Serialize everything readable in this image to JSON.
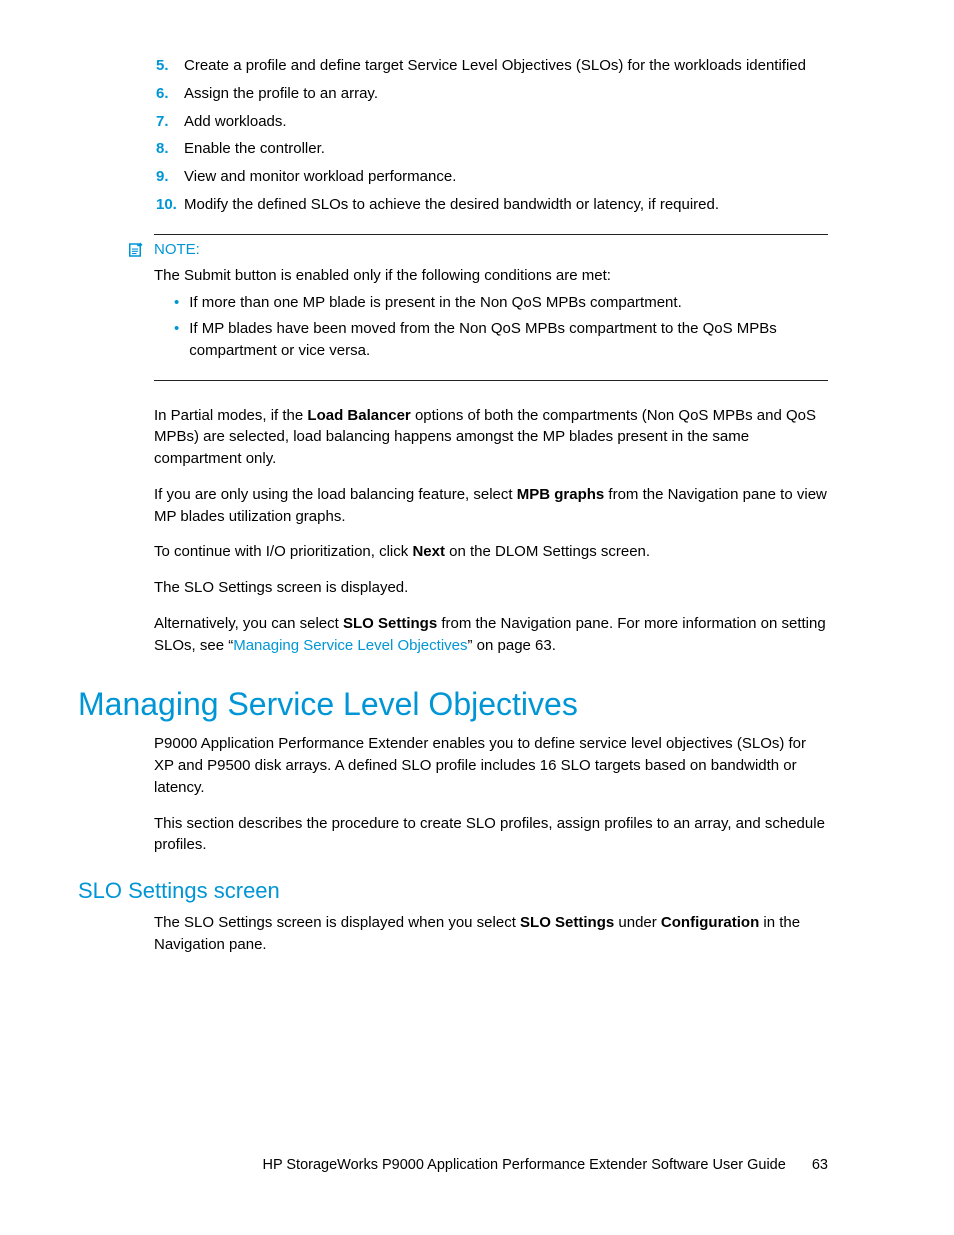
{
  "ol": [
    {
      "n": "5.",
      "t": "Create a profile and define target Service Level Objectives (SLOs) for the workloads identified"
    },
    {
      "n": "6.",
      "t": "Assign the profile to an array."
    },
    {
      "n": "7.",
      "t": "Add workloads."
    },
    {
      "n": "8.",
      "t": "Enable the controller."
    },
    {
      "n": "9.",
      "t": "View and monitor workload performance."
    },
    {
      "n": "10.",
      "t": "Modify the defined SLOs to achieve the desired bandwidth or latency, if required."
    }
  ],
  "note": {
    "label": "NOTE:",
    "intro": "The Submit button is enabled only if the following conditions are met:",
    "bullets": [
      "If more than one MP blade is present in the Non QoS MPBs compartment.",
      "If MP blades have been moved from the Non QoS MPBs compartment to the QoS MPBs compartment or vice versa."
    ]
  },
  "p1": {
    "a": "In Partial modes, if the ",
    "b": "Load Balancer",
    "c": " options of both the compartments (Non QoS MPBs and QoS MPBs) are selected, load balancing happens amongst the MP blades present in the same compartment only."
  },
  "p2": {
    "a": "If you are only using the load balancing feature, select ",
    "b": "MPB graphs",
    "c": " from the Navigation pane to view MP blades utilization graphs."
  },
  "p3": {
    "a": "To continue with I/O prioritization, click ",
    "b": "Next",
    "c": " on the DLOM Settings screen."
  },
  "p4": "The SLO Settings screen is displayed.",
  "p5": {
    "a": "Alternatively, you can select ",
    "b": "SLO Settings",
    "c": " from the Navigation pane. For more information on setting SLOs, see “",
    "link": "Managing Service Level Objectives",
    "d": "” on page 63."
  },
  "h1": "Managing Service Level Objectives",
  "s1p1": "P9000 Application Performance Extender enables you to define service level objectives (SLOs) for XP and P9500 disk arrays. A defined SLO profile includes 16 SLO targets based on bandwidth or latency.",
  "s1p2": "This section describes the procedure to create SLO profiles, assign profiles to an array, and schedule profiles.",
  "h2": "SLO Settings screen",
  "s2p1": {
    "a": "The SLO Settings screen is displayed when you select ",
    "b": "SLO Settings",
    "c": " under ",
    "d": "Configuration",
    "e": " in the Navigation pane."
  },
  "footer": {
    "title": "HP StorageWorks P9000 Application Performance Extender Software User Guide",
    "page": "63"
  }
}
